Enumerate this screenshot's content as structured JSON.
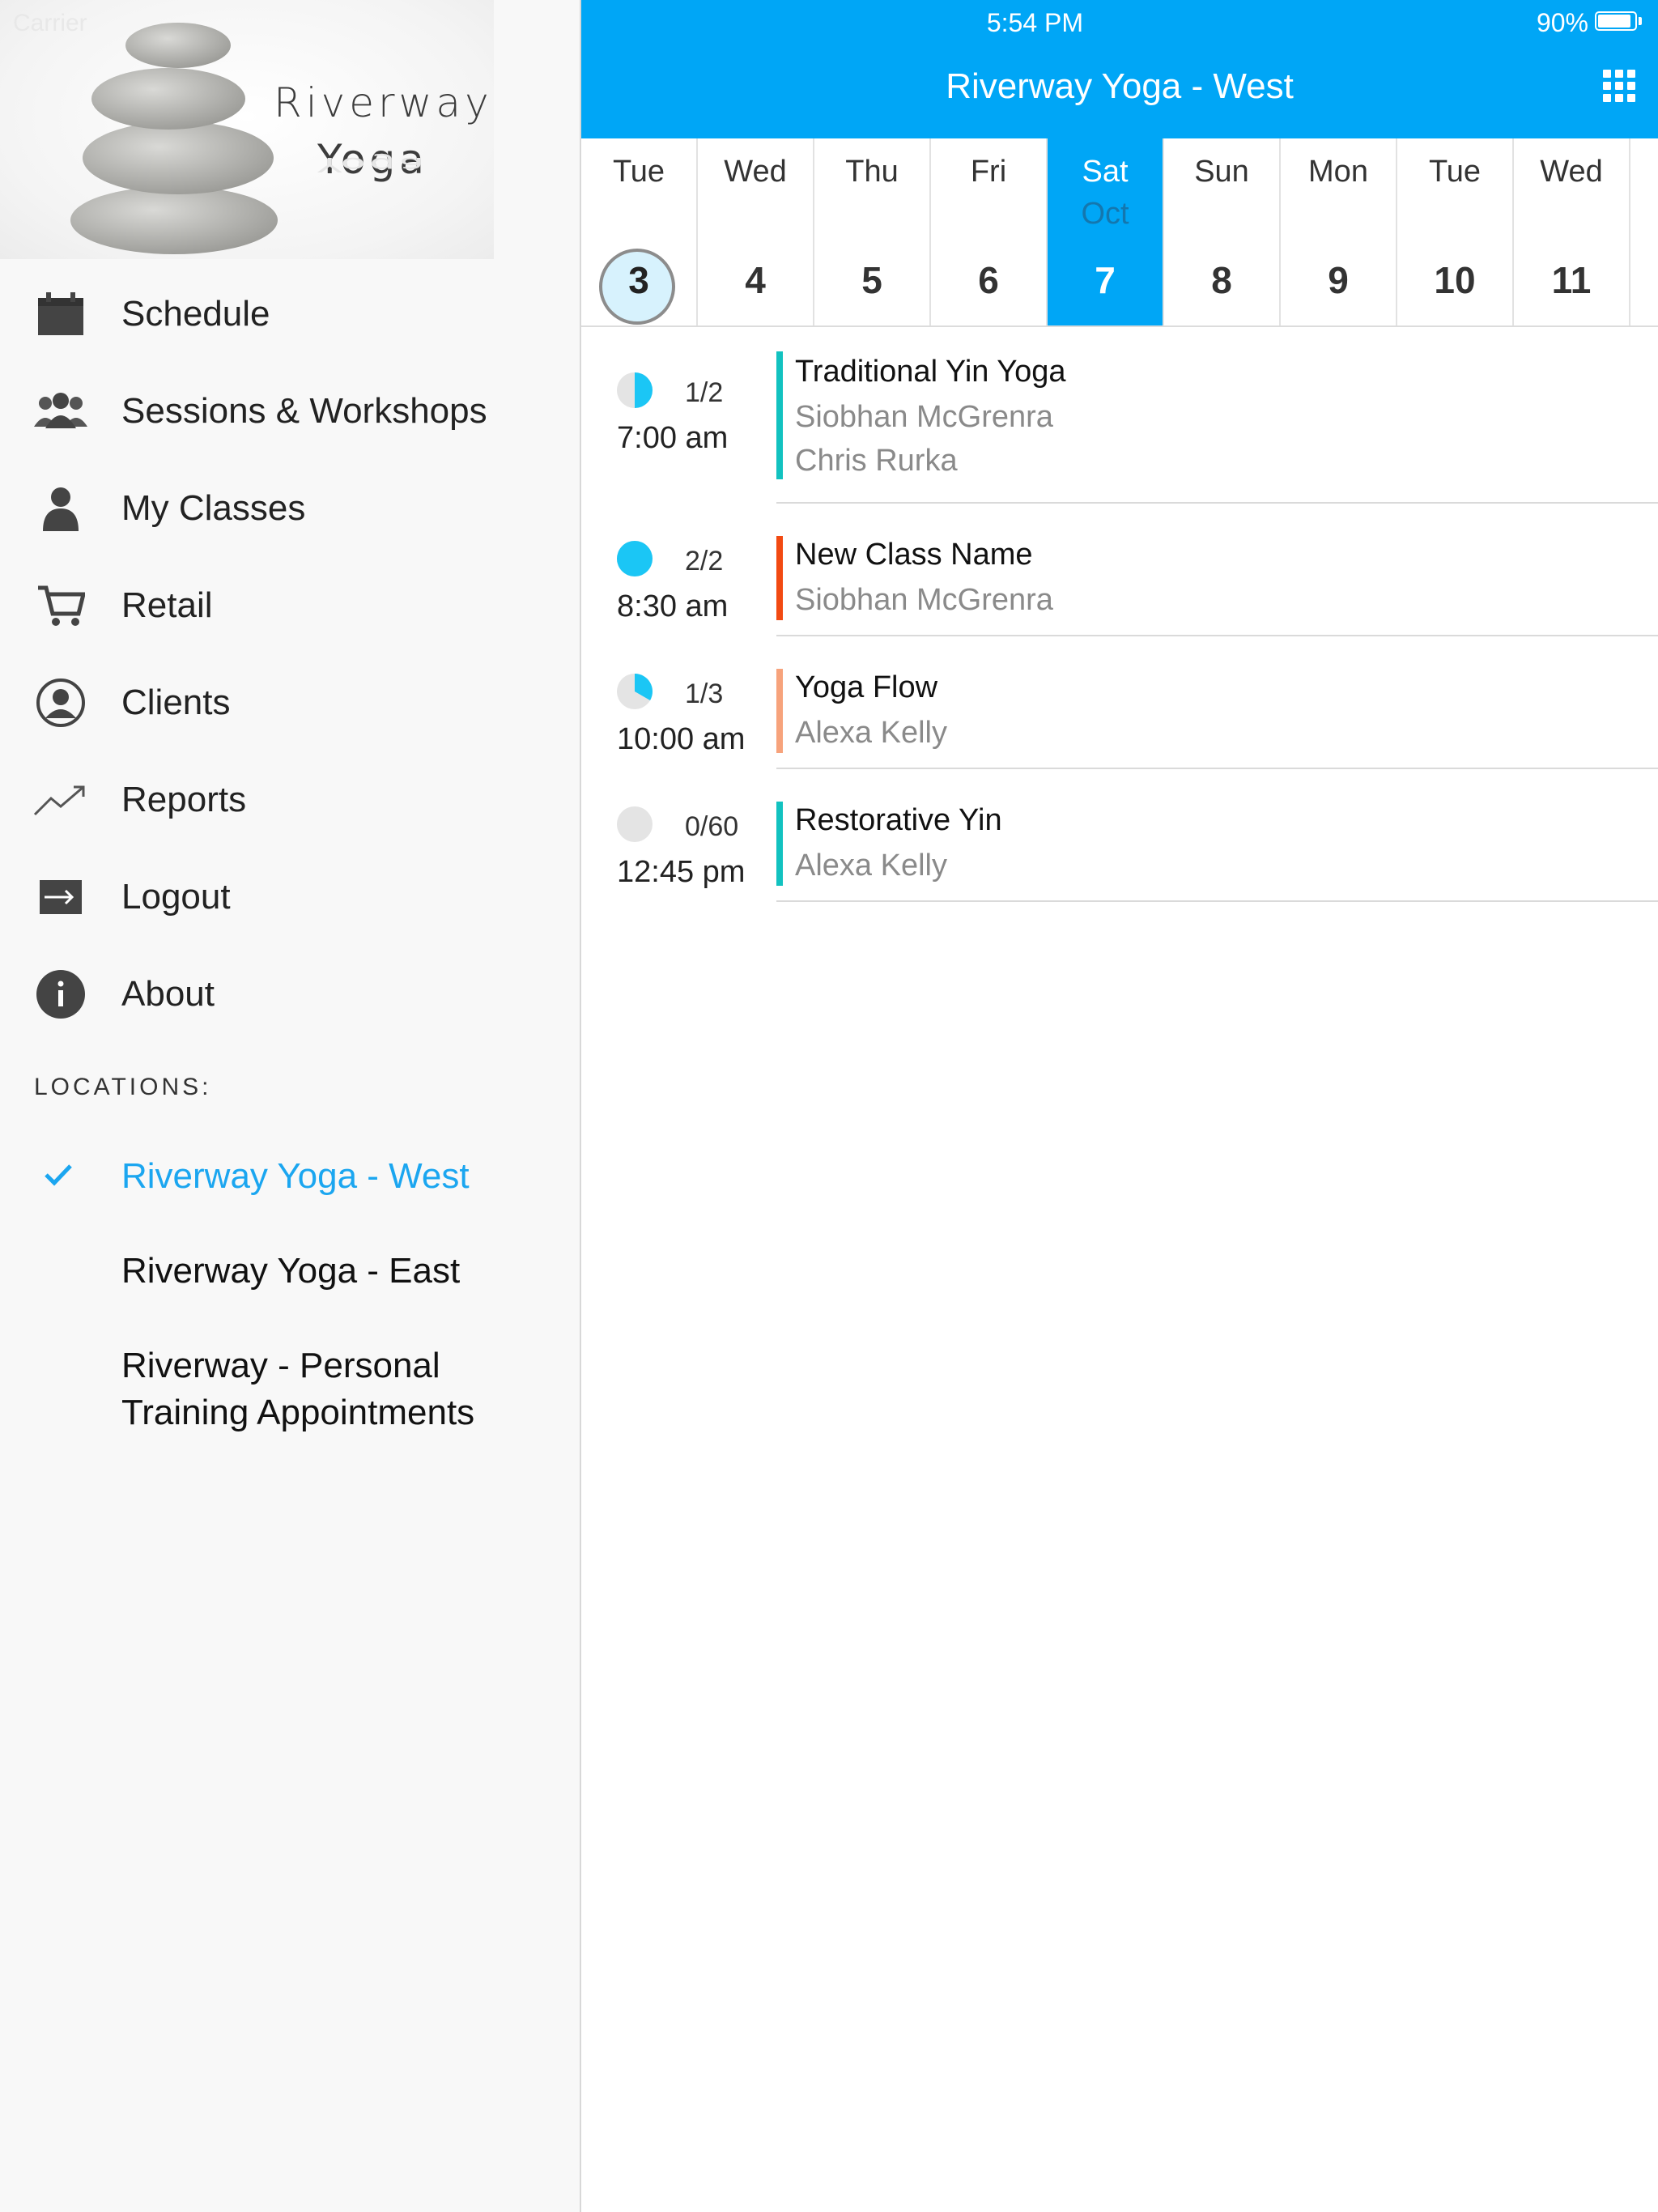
{
  "status_bar": {
    "carrier": "Carrier",
    "time": "5:54 PM",
    "battery": "90%"
  },
  "sidebar": {
    "logo": {
      "line1": "Riverway",
      "line2": "Yoga"
    },
    "menu": [
      {
        "label": "Schedule",
        "icon": "calendar-icon"
      },
      {
        "label": "Sessions & Workshops",
        "icon": "group-icon"
      },
      {
        "label": "My Classes",
        "icon": "person-icon"
      },
      {
        "label": "Retail",
        "icon": "cart-icon"
      },
      {
        "label": "Clients",
        "icon": "user-circle-icon"
      },
      {
        "label": "Reports",
        "icon": "trend-icon"
      },
      {
        "label": "Logout",
        "icon": "logout-icon"
      },
      {
        "label": "About",
        "icon": "info-icon"
      }
    ],
    "locations_header": "LOCATIONS:",
    "locations": [
      {
        "label": "Riverway Yoga - West",
        "selected": true
      },
      {
        "label": "Riverway Yoga - East",
        "selected": false
      },
      {
        "label_line1": "Riverway - Personal",
        "label_line2": "Training Appointments",
        "selected": false
      }
    ]
  },
  "header": {
    "title": "Riverway Yoga - West",
    "grid_icon": "grid-menu-icon"
  },
  "days": [
    {
      "name": "Tue",
      "num": "3",
      "today": true
    },
    {
      "name": "Wed",
      "num": "4"
    },
    {
      "name": "Thu",
      "num": "5"
    },
    {
      "name": "Fri",
      "num": "6"
    },
    {
      "name": "Sat",
      "num": "7",
      "month": "Oct",
      "selected": true
    },
    {
      "name": "Sun",
      "num": "8"
    },
    {
      "name": "Mon",
      "num": "9"
    },
    {
      "name": "Tue",
      "num": "10"
    },
    {
      "name": "Wed",
      "num": "11"
    }
  ],
  "classes": [
    {
      "count": "1/2",
      "fill": 0.5,
      "time": "7:00 am",
      "name": "Traditional Yin Yoga",
      "instructors": [
        "Siobhan McGrenra",
        "Chris Rurka"
      ],
      "color": "#12c2c0"
    },
    {
      "count": "2/2",
      "fill": 1.0,
      "time": "8:30 am",
      "name": "New Class Name",
      "instructors": [
        "Siobhan McGrenra"
      ],
      "color": "#f24a12"
    },
    {
      "count": "1/3",
      "fill": 0.333,
      "time": "10:00 am",
      "name": "Yoga Flow",
      "instructors": [
        "Alexa Kelly"
      ],
      "color": "#f7a37c"
    },
    {
      "count": "0/60",
      "fill": 0,
      "time": "12:45 pm",
      "name": "Restorative Yin",
      "instructors": [
        "Alexa Kelly"
      ],
      "color": "#12c2c0"
    }
  ],
  "colors": {
    "accent": "#00a6f6",
    "pie": "#1bc6f5",
    "pie_bg": "#e4e4e4"
  }
}
